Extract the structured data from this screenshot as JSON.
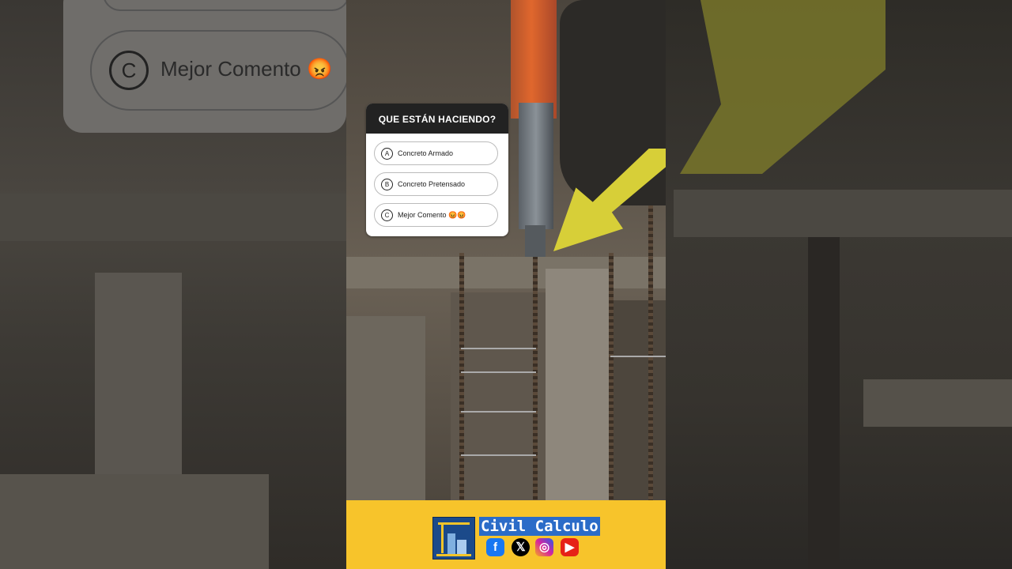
{
  "quiz": {
    "question": "QUE ESTÁN HACIENDO?",
    "options": [
      {
        "letter": "A",
        "text": "Concreto Armado"
      },
      {
        "letter": "B",
        "text": "Concreto Pretensado"
      },
      {
        "letter": "C",
        "text": "Mejor Comento 😡😡"
      }
    ]
  },
  "background_blur": {
    "letter": "C",
    "text": "Mejor Comento 😡"
  },
  "footer": {
    "brand": "Civil Calculo",
    "social_icons": [
      "facebook-icon",
      "x-icon",
      "instagram-icon",
      "youtube-icon"
    ],
    "colors": {
      "background": "#f7c42b",
      "brand_bg": "#2b6cc8",
      "arrow": "#d7cf38"
    }
  }
}
